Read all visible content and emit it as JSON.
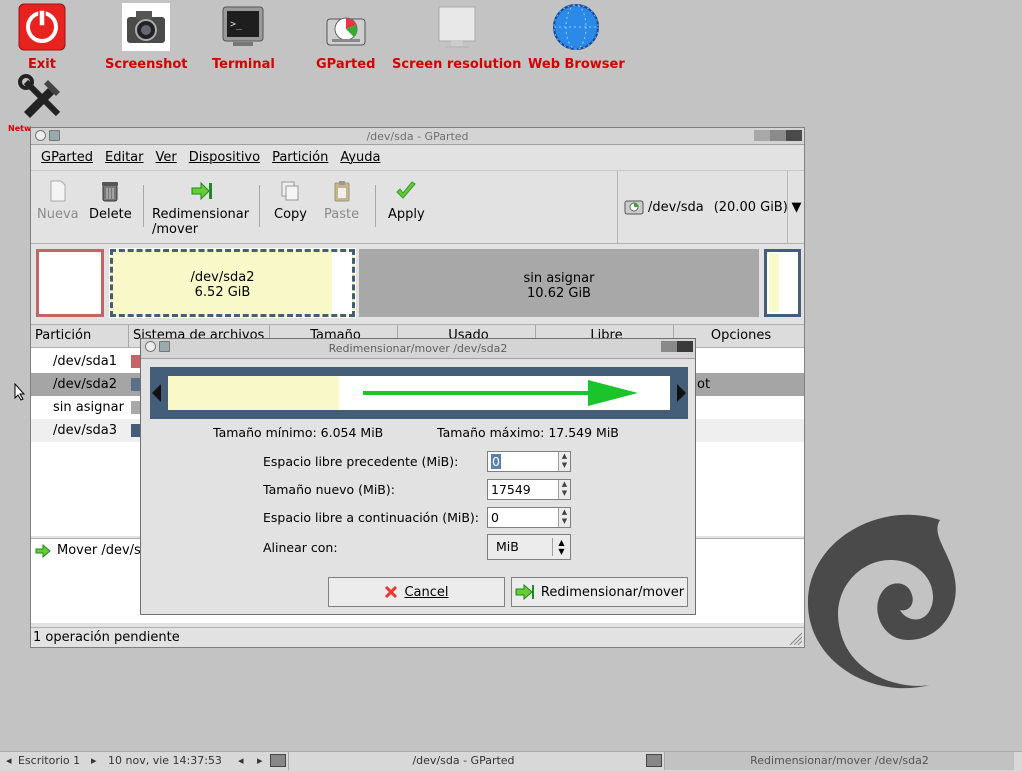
{
  "desktop": {
    "icons": [
      {
        "label": "Exit",
        "icon": "power-icon"
      },
      {
        "label": "Screenshot",
        "icon": "camera-icon"
      },
      {
        "label": "Terminal",
        "icon": "terminal-icon"
      },
      {
        "label": "GParted",
        "icon": "disk-icon"
      },
      {
        "label": "Screen resolution",
        "icon": "monitor-icon"
      },
      {
        "label": "Web Browser",
        "icon": "globe-icon"
      },
      {
        "label": "Netw",
        "icon": "tools-icon"
      }
    ],
    "label_color": "#d40000"
  },
  "window": {
    "title": "/dev/sda - GParted",
    "menu": [
      "GParted",
      "Editar",
      "Ver",
      "Dispositivo",
      "Partición",
      "Ayuda"
    ],
    "toolbar": {
      "nueva": "Nueva",
      "delete": "Delete",
      "resize_line1": "Redimensionar",
      "resize_line2": "/mover",
      "copy": "Copy",
      "paste": "Paste",
      "apply": "Apply"
    },
    "device": {
      "name": "/dev/sda",
      "size": "(20.00 GiB)"
    },
    "map": {
      "sda2_name": "/dev/sda2",
      "sda2_size": "6.52 GiB",
      "unalloc_name": "sin asignar",
      "unalloc_size": "10.62 GiB"
    },
    "columns": [
      "Partición",
      "Sistema de archivos",
      "Tamaño",
      "Usado",
      "Libre",
      "Opciones"
    ],
    "rows": [
      {
        "name": "/dev/sda1",
        "color": "#c46464"
      },
      {
        "name": "/dev/sda2",
        "color": "#5b7089",
        "opt_fragment": "ot"
      },
      {
        "name": "sin asignar",
        "color": "#a8a8a8"
      },
      {
        "name": "/dev/sda3",
        "color": "#445d78"
      }
    ],
    "pending_op": "Mover /dev/sc",
    "status": "1 operación pendiente"
  },
  "dialog": {
    "title": "Redimensionar/mover /dev/sda2",
    "min_size": "Tamaño mínimo: 6.054 MiB",
    "max_size": "Tamaño máximo: 17.549 MiB",
    "fields": {
      "free_before_label": "Espacio libre precedente (MiB):",
      "free_before_value": "0",
      "new_size_label": "Tamaño nuevo (MiB):",
      "new_size_value": "17549",
      "free_after_label": "Espacio libre a continuación (MiB):",
      "free_after_value": "0",
      "align_label": "Alinear con:",
      "align_value": "MiB"
    },
    "cancel": "Cancel",
    "apply": "Redimensionar/mover",
    "used_fraction": 0.34
  },
  "taskbar": {
    "desktop": "Escritorio 1",
    "datetime": "10 nov, vie 14:37:53",
    "task1": "/dev/sda - GParted",
    "task2": "Redimensionar/mover /dev/sda2"
  }
}
